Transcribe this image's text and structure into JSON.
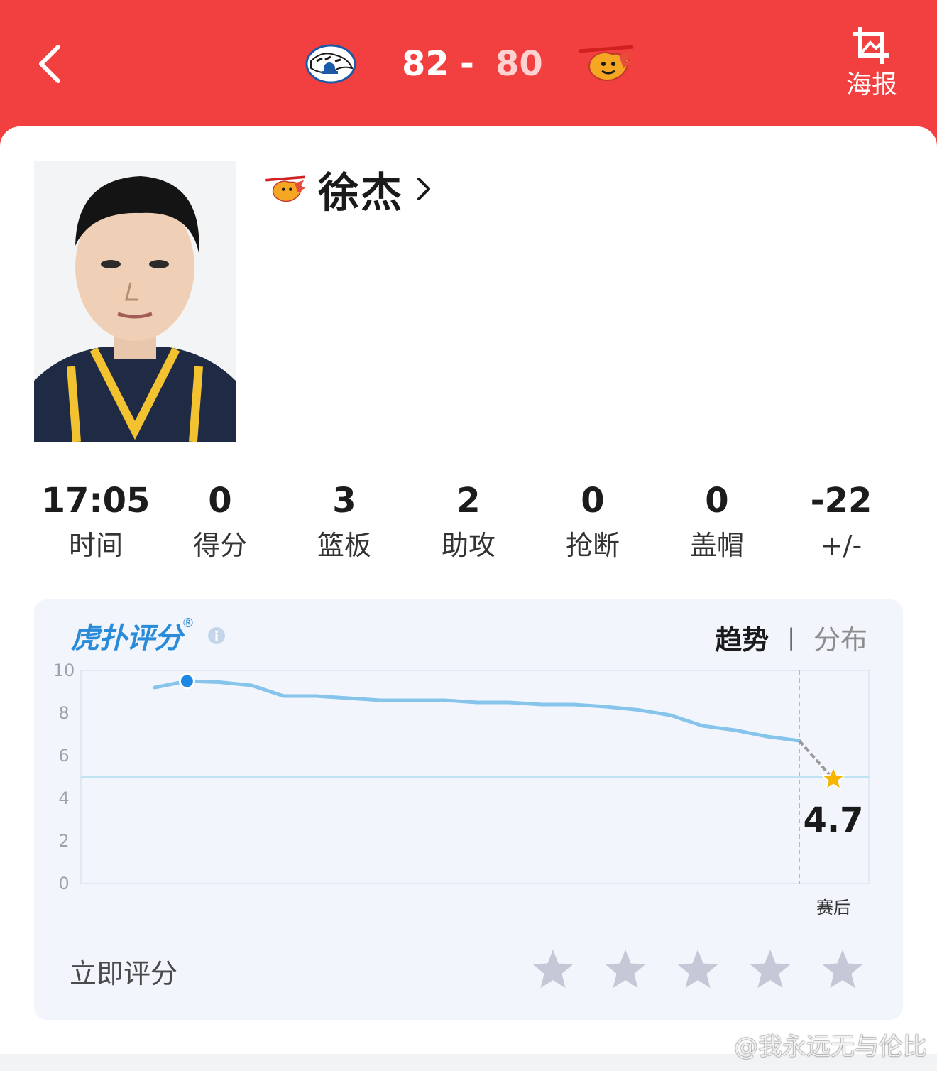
{
  "header": {
    "home_team_logo": "tiger-logo",
    "away_team_logo": "lion-logo",
    "home_score": "82",
    "dash": "-",
    "away_score": "80",
    "poster_label": "海报"
  },
  "player": {
    "name": "徐杰",
    "team_logo": "lion-logo"
  },
  "stats": [
    {
      "value": "17:05",
      "label": "时间"
    },
    {
      "value": "0",
      "label": "得分"
    },
    {
      "value": "3",
      "label": "篮板"
    },
    {
      "value": "2",
      "label": "助攻"
    },
    {
      "value": "0",
      "label": "抢断"
    },
    {
      "value": "0",
      "label": "盖帽"
    },
    {
      "value": "-22",
      "label": "+/-"
    }
  ],
  "rating": {
    "brand": "虎扑评分",
    "brand_mark": "®",
    "tab_trend": "趋势",
    "tab_separator": "|",
    "tab_distribution": "分布",
    "rate_now": "立即评分",
    "star_count": 5
  },
  "chart_data": {
    "type": "line",
    "yticks": [
      "10",
      "8",
      "6",
      "4",
      "2",
      "0"
    ],
    "ylim": [
      0,
      10
    ],
    "series": [
      {
        "values": [
          9.2,
          9.5,
          9.45,
          9.3,
          8.8,
          8.8,
          8.7,
          8.6,
          8.6,
          8.6,
          8.5,
          8.5,
          8.4,
          8.4,
          8.3,
          8.15,
          7.9,
          7.4,
          7.2,
          6.9,
          6.7
        ]
      }
    ],
    "final_value": "4.7",
    "final_label": "赛后",
    "reference_line": 5.0,
    "colors": {
      "line": "#86c4ec",
      "marker": "#1e88e5",
      "star": "#f7b500",
      "final_segment": "#9a9a9a"
    }
  },
  "watermark": "@我永远无与伦比"
}
